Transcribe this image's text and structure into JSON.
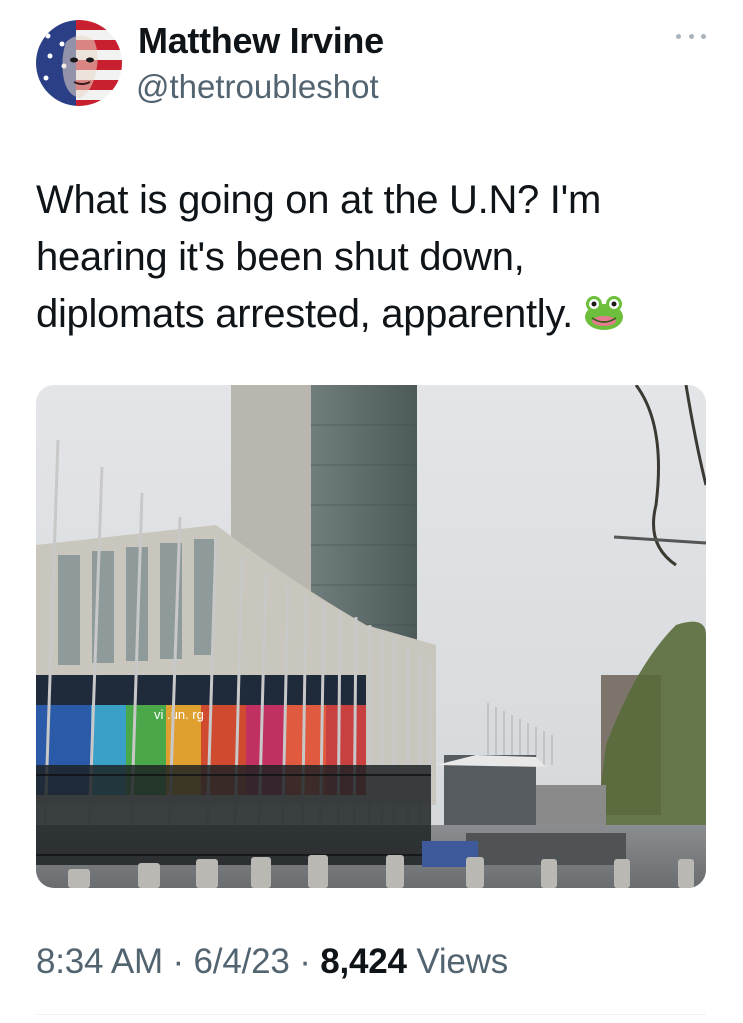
{
  "author": {
    "display_name": "Matthew Irvine",
    "handle": "@thetroubleshot",
    "avatar_icon": "stars-and-stripes-face-avatar"
  },
  "tweet": {
    "text_lines": [
      "What is going on at the U.N? I'm",
      "hearing it's been shut down,",
      "diplomats arrested, apparently."
    ],
    "emoji": "frog-face-emoji"
  },
  "media": {
    "sign_text": "vi  .un.  rg",
    "description_icon": "un-headquarters-photo"
  },
  "meta": {
    "time": "8:34 AM",
    "sep1": "·",
    "date": "6/4/23",
    "sep2": "·",
    "views_count": "8,424",
    "views_label": "Views"
  },
  "colors": {
    "text_primary": "#0f1419",
    "text_secondary": "#536471",
    "divider": "#eff3f4"
  }
}
